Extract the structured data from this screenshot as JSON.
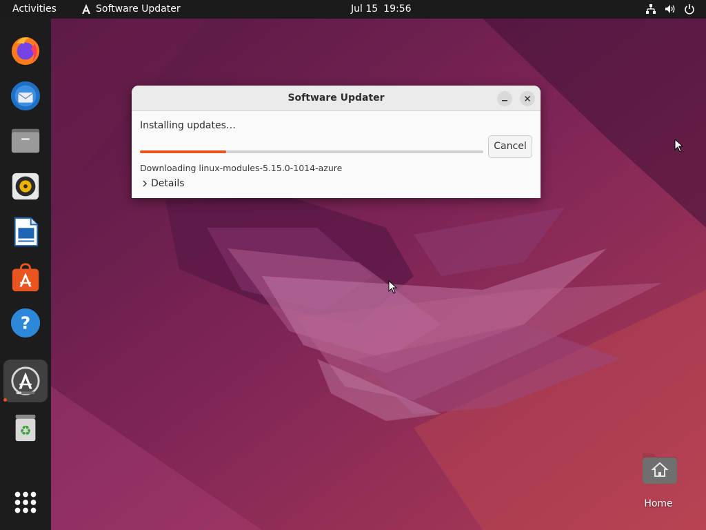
{
  "topbar": {
    "activities_label": "Activities",
    "app_name": "Software Updater",
    "date": "Jul 15",
    "time": "19:56",
    "tray_icons": [
      "network-icon",
      "volume-icon",
      "power-icon"
    ]
  },
  "dock": {
    "items": [
      {
        "name": "firefox",
        "icon": "firefox-icon"
      },
      {
        "name": "thunderbird",
        "icon": "thunderbird-icon"
      },
      {
        "name": "files",
        "icon": "files-icon"
      },
      {
        "name": "rhythmbox",
        "icon": "rhythmbox-icon"
      },
      {
        "name": "libreoffice-writer",
        "icon": "writer-icon"
      },
      {
        "name": "app-center",
        "icon": "app-center-icon"
      },
      {
        "name": "help",
        "icon": "help-icon"
      },
      {
        "name": "software-updater",
        "icon": "software-updater-icon",
        "active": true
      },
      {
        "name": "trash",
        "icon": "trash-icon"
      },
      {
        "name": "show-apps",
        "icon": "app-grid-icon"
      }
    ]
  },
  "dialog": {
    "title": "Software Updater",
    "status": "Installing updates…",
    "progress": 0.25,
    "cancel_label": "Cancel",
    "download_text": "Downloading linux-modules-5.15.0-1014-azure",
    "details_label": "Details"
  },
  "desktop": {
    "home_label": "Home"
  },
  "colors": {
    "accent": "#e95420",
    "topbar": "#1b1b1b",
    "dock": "#1c1c1c",
    "dialog_bg": "#fafafa"
  }
}
